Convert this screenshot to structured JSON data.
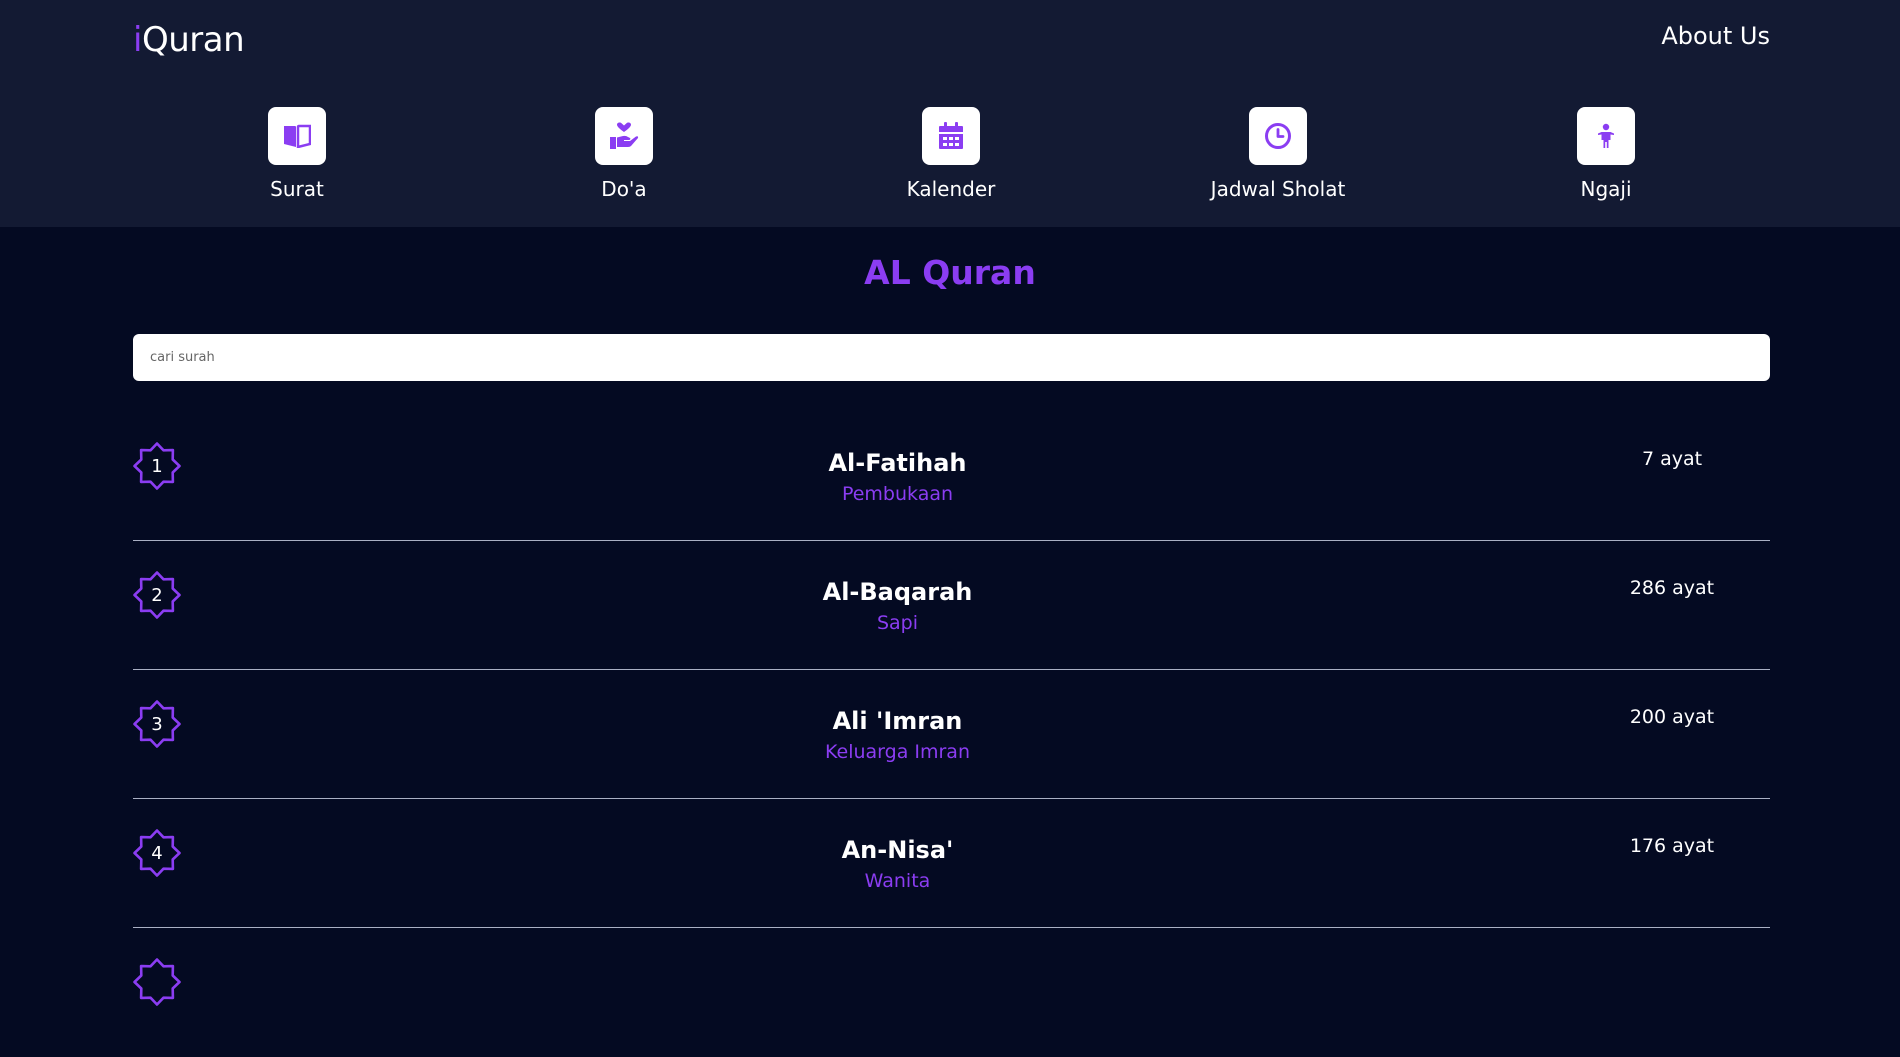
{
  "header": {
    "brand_prefix": "i",
    "brand_rest": "Quran",
    "about_label": "About Us"
  },
  "nav": [
    {
      "label": "Surat",
      "icon": "book-open-icon"
    },
    {
      "label": "Do'a",
      "icon": "hand-heart-icon"
    },
    {
      "label": "Kalender",
      "icon": "calendar-icon"
    },
    {
      "label": "Jadwal Sholat",
      "icon": "clock-icon"
    },
    {
      "label": "Ngaji",
      "icon": "child-icon"
    }
  ],
  "main": {
    "title": "AL Quran",
    "search_placeholder": "cari surah"
  },
  "surahs": [
    {
      "number": "1",
      "name": "Al-Fatihah",
      "meaning": "Pembukaan",
      "ayat": "7 ayat"
    },
    {
      "number": "2",
      "name": "Al-Baqarah",
      "meaning": "Sapi",
      "ayat": "286 ayat"
    },
    {
      "number": "3",
      "name": "Ali 'Imran",
      "meaning": "Keluarga Imran",
      "ayat": "200 ayat"
    },
    {
      "number": "4",
      "name": "An-Nisa'",
      "meaning": "Wanita",
      "ayat": "176 ayat"
    }
  ],
  "colors": {
    "accent": "#8b3df2",
    "header_bg": "#131a33",
    "page_bg": "#040a22"
  }
}
